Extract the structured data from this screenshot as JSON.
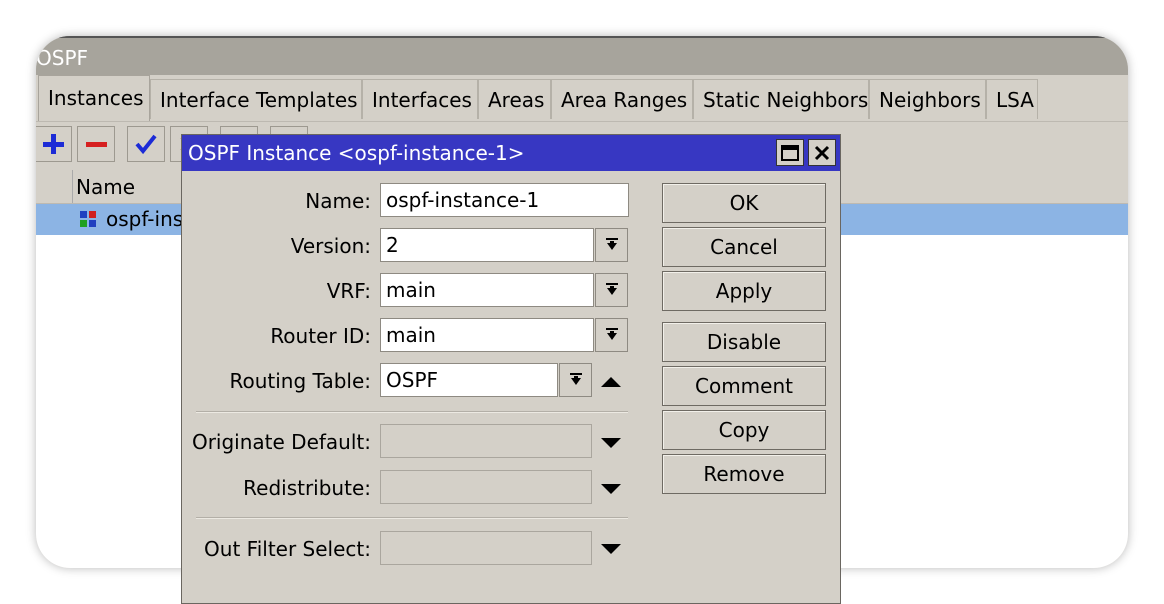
{
  "window": {
    "title": "OSPF"
  },
  "tabs": [
    {
      "label": "Instances"
    },
    {
      "label": "Interface Templates"
    },
    {
      "label": "Interfaces"
    },
    {
      "label": "Areas"
    },
    {
      "label": "Area Ranges"
    },
    {
      "label": "Static Neighbors"
    },
    {
      "label": "Neighbors"
    },
    {
      "label": "LSA"
    }
  ],
  "toolbar": {
    "icons": [
      "add-icon",
      "remove-icon",
      "enable-icon",
      "disable-icon",
      "comment-icon",
      "filter-icon"
    ]
  },
  "table": {
    "columns": [
      "Name"
    ],
    "rows": [
      {
        "name": "ospf-ins"
      }
    ]
  },
  "dialog": {
    "title": "OSPF Instance <ospf-instance-1>",
    "fields": {
      "name": {
        "label": "Name:",
        "value": "ospf-instance-1"
      },
      "version": {
        "label": "Version:",
        "value": "2"
      },
      "vrf": {
        "label": "VRF:",
        "value": "main"
      },
      "router_id": {
        "label": "Router ID:",
        "value": "main"
      },
      "routing_table": {
        "label": "Routing Table:",
        "value": "OSPF"
      },
      "originate_default": {
        "label": "Originate Default:",
        "value": ""
      },
      "redistribute": {
        "label": "Redistribute:",
        "value": ""
      },
      "out_filter_select": {
        "label": "Out Filter Select:",
        "value": ""
      }
    },
    "buttons": {
      "ok": "OK",
      "cancel": "Cancel",
      "apply": "Apply",
      "disable": "Disable",
      "comment": "Comment",
      "copy": "Copy",
      "remove": "Remove"
    }
  },
  "colors": {
    "dialog_title_bg": "#3737c2",
    "selected_row_bg": "#8cb4e4",
    "window_bg": "#d4d0c8",
    "add_icon": "#1c2bd6",
    "remove_icon": "#d62020"
  }
}
